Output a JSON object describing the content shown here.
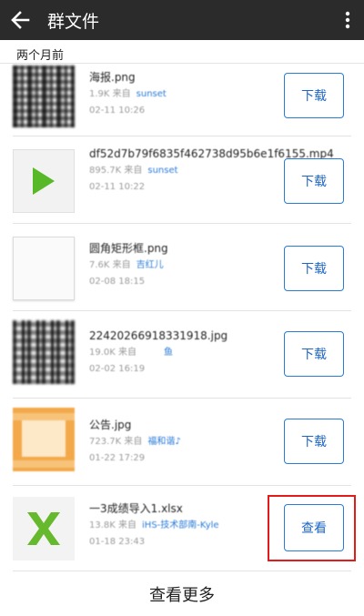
{
  "header": {
    "title": "群文件",
    "back_icon": "back-arrow-icon",
    "more_icon": "more-vertical-icon"
  },
  "section": {
    "label": "两个月前"
  },
  "files": [
    {
      "name": "海报.png",
      "meta": "1.9K 来自",
      "sender": "sunset",
      "date": "02-11 10:26",
      "action": "下载",
      "thumb": "qr-image"
    },
    {
      "name": "df52d7b79f6835f462738d95b6e1f6155.mp4",
      "meta": "895.7K 来自",
      "sender": "sunset",
      "date": "02-11 10:22",
      "action": "下载",
      "thumb": "video-play-icon"
    },
    {
      "name": "圆角矩形框.png",
      "meta": "7.6K 来自",
      "sender": "吉红儿",
      "date": "02-08 18:15",
      "action": "下载",
      "thumb": "blank-image"
    },
    {
      "name": "22420266918331918.jpg",
      "meta": "19.0K 来自",
      "sender": "鱼",
      "date": "02-02 16:19",
      "action": "下载",
      "thumb": "qr-image"
    },
    {
      "name": "公告.jpg",
      "meta": "723.7K 来自",
      "sender": "福和谐♪",
      "date": "01-22 17:29",
      "action": "下载",
      "thumb": "orange-image"
    },
    {
      "name": "一3成绩导入1.xlsx",
      "meta": "13.8K 来自",
      "sender": "iHS-技术部南-Kyle",
      "date": "01-18 23:43",
      "action": "查看",
      "thumb": "excel-icon"
    }
  ],
  "footer": {
    "label": "查看更多"
  },
  "colors": {
    "topbar": "#2b2b2b",
    "accent": "#2a7bd6",
    "highlight": "#e31a1a"
  }
}
